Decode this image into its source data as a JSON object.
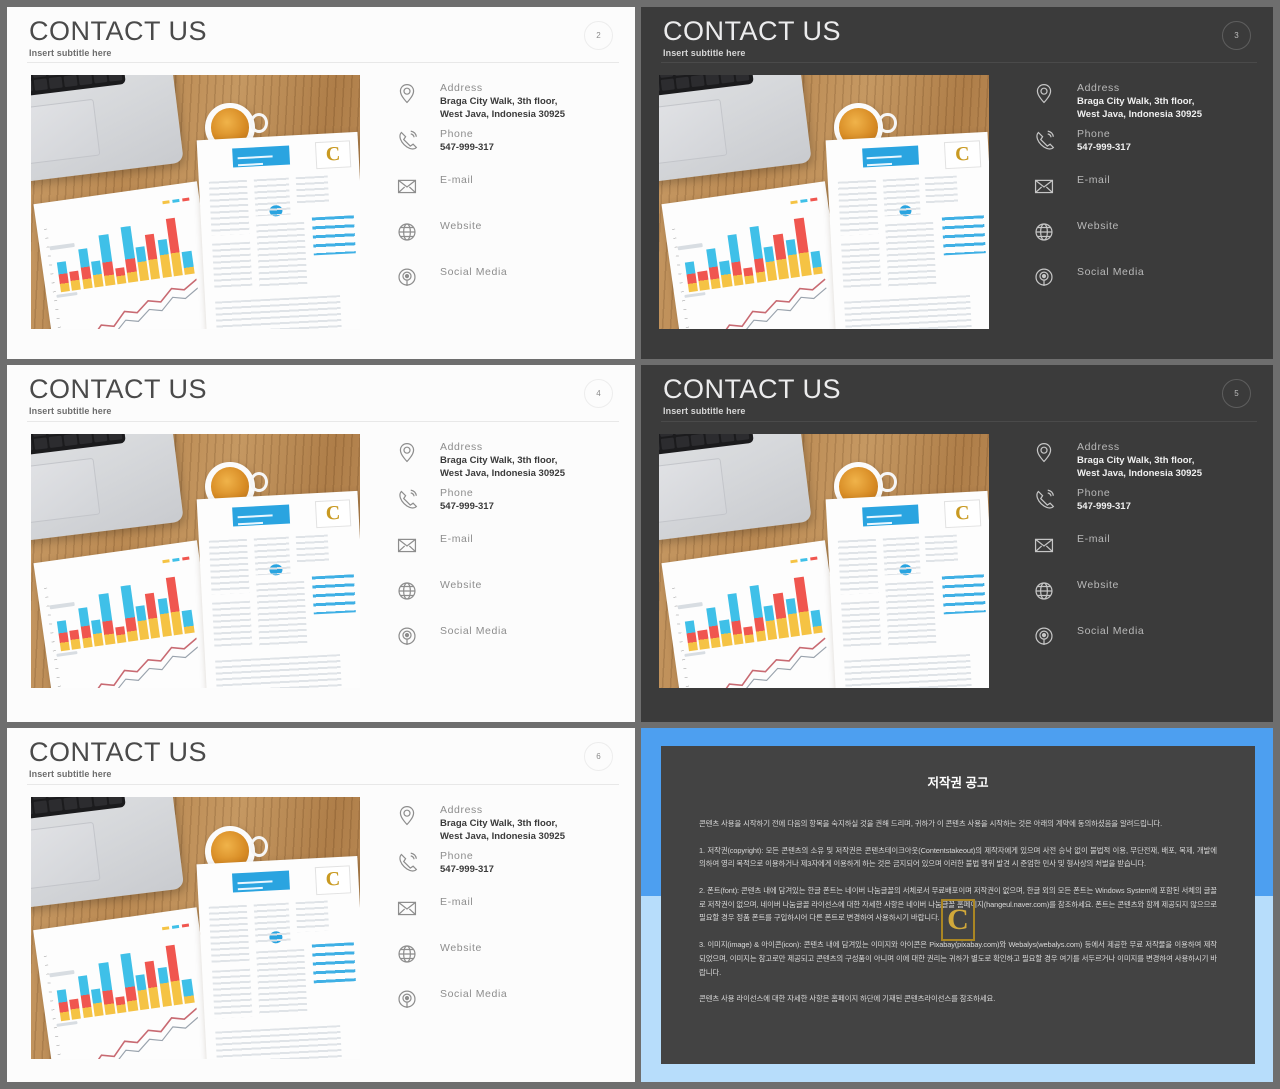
{
  "slides": [
    {
      "id": "slide-2",
      "theme": "light",
      "page": "2",
      "title": "CONTACT US",
      "subtitle": "Insert subtitle here"
    },
    {
      "id": "slide-3",
      "theme": "dark",
      "page": "3",
      "title": "CONTACT US",
      "subtitle": "Insert subtitle here"
    },
    {
      "id": "slide-4",
      "theme": "light",
      "page": "4",
      "title": "CONTACT US",
      "subtitle": "Insert subtitle here"
    },
    {
      "id": "slide-5",
      "theme": "dark",
      "page": "5",
      "title": "CONTACT US",
      "subtitle": "Insert subtitle here"
    },
    {
      "id": "slide-6",
      "theme": "light",
      "page": "6",
      "title": "CONTACT US",
      "subtitle": "Insert subtitle here"
    }
  ],
  "contacts": [
    {
      "icon": "location-pin-icon",
      "label": "Address",
      "value": "Braga City Walk, 3th floor,\nWest Java, Indonesia 30925"
    },
    {
      "icon": "phone-icon",
      "label": "Phone",
      "value": "547-999-317"
    },
    {
      "icon": "envelope-icon",
      "label": "E-mail",
      "value": ""
    },
    {
      "icon": "globe-icon",
      "label": "Website",
      "value": ""
    },
    {
      "icon": "social-media-icon",
      "label": "Social  Media",
      "value": ""
    }
  ],
  "photo": {
    "alt": "desk-photo-laptop-coffee-documents",
    "chart_bar_colors": [
      "#f5c344",
      "#f0564f",
      "#3fc0e8"
    ],
    "accent_blue": "#2aa4e0",
    "logo_letter": "C"
  },
  "copyright": {
    "title": "저작권 공고",
    "watermark_letter": "C",
    "frame_top_color": "#4d9ff0",
    "frame_bottom_color": "#b7ddfb",
    "box_color": "#434343",
    "paragraphs": [
      "콘텐츠 사용을 시작하기 전에 다음의 항목을 숙지하실 것을 권해 드리며, 귀하가 이 콘텐츠 사용을 시작하는 것은 아래의 계약에 동의하셨음을 알려드립니다.",
      "1. 저작권(copyright): 모든 콘텐츠의 소유 및 저작권은 콘텐츠테이크아웃(Contentstakeout)의 제작자에게 있으며 사전 승낙 없이 불법적 이용, 무단전재, 배포, 복제, 개발에 의하여 영리 목적으로 이용하거나 제3자에게 이용하게 하는 것은 금지되어 있으며 이러한 불법 행위 발견 시 준엄한 민사 및 형사상의 처벌을 받습니다.",
      "2. 폰트(font): 콘텐츠 내에 담겨있는 한글 폰트는 네이버 나눔글꼴의 서체로서 무료배포이며 저작권이 없으며, 한글 외의 모든 폰트는 Windows System에 포함된 서체의 글꼴로 저작권이 없으며, 네이버 나눔글꼴 라이선스에 대한 자세한 사항은 네이버 나눔글꼴 홈페이지(hangeul.naver.com)를 참조하세요. 폰트는 콘텐츠와 함께 제공되지 않으므로 필요할 경우 정품 폰트를 구입하시어 다른 폰트로 변경하여 사용하시기 바랍니다.",
      "3. 이미지(image) & 아이콘(icon): 콘텐츠 내에 담겨있는 이미지와 아이콘은 Pixabay(pixabay.com)와 Webalys(webalys.com) 등에서 제공한 무료 저작물을 이용하여 제작되었으며, 이미지는 참고로만 제공되고 콘텐츠의 구성품이 아니며 이에 대한 권리는 귀하가 별도로 확인하고 필요할 경우 여기를 서두르거나 이미지를 변경하여 사용하시기 바랍니다.",
      "콘텐츠 사용 라이선스에 대한 자세한 사항은 홈페이지 하단에 기재된 콘텐츠라이선스를 참조하세요."
    ]
  }
}
